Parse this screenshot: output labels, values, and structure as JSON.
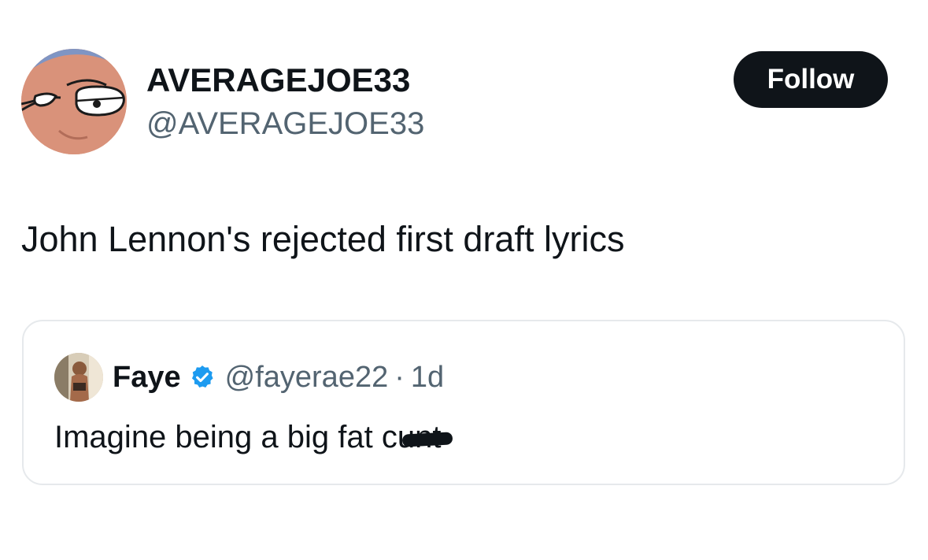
{
  "post": {
    "author": {
      "display_name": "AVERAGEJOE33",
      "handle": "@AVERAGEJOE33",
      "avatar_icon": "cartoon-face-avatar"
    },
    "follow_label": "Follow",
    "text": "John Lennon's rejected first draft lyrics"
  },
  "quote": {
    "author": {
      "display_name": "Faye",
      "handle": "@fayerae22",
      "verified": true,
      "avatar_icon": "profile-photo-avatar"
    },
    "separator": "·",
    "time": "1d",
    "text_prefix": "Imagine being a big fat c",
    "text_censored": "unt"
  },
  "colors": {
    "text": "#0f1419",
    "secondary_text": "#536471",
    "follow_bg": "#0f1419",
    "verified": "#1d9bf0",
    "border": "#e6e9ec"
  }
}
